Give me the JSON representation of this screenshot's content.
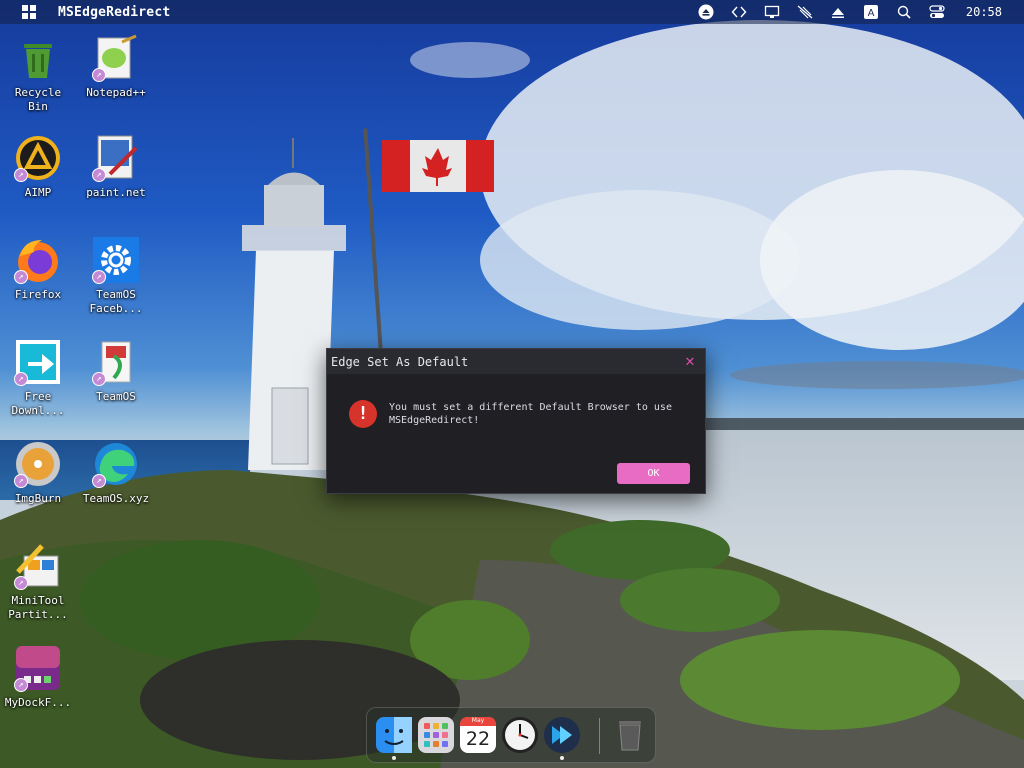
{
  "topbar": {
    "app_title": "MSEdgeRedirect",
    "tray_icons": [
      "eject-icon",
      "code-brackets-icon",
      "monitor-icon",
      "network-off-icon",
      "up-arrow-icon",
      "keyboard-a-icon",
      "search-icon",
      "toggle-icon"
    ],
    "keyboard_letter": "A",
    "clock": "20:58"
  },
  "desktop": {
    "icons": [
      {
        "label": "Recycle\nBin",
        "icon": "recycle-bin-icon"
      },
      {
        "label": "Notepad++",
        "icon": "notepad-plus-plus-icon"
      },
      {
        "label": "AIMP",
        "icon": "aimp-icon"
      },
      {
        "label": "paint.net",
        "icon": "paint-net-icon"
      },
      {
        "label": "Firefox",
        "icon": "firefox-icon"
      },
      {
        "label": "TeamOS\nFaceb...",
        "icon": "gear-icon"
      },
      {
        "label": "Free\nDownl...",
        "icon": "free-download-icon"
      },
      {
        "label": "TeamOS",
        "icon": "teamos-icon"
      },
      {
        "label": "ImgBurn",
        "icon": "imgburn-icon"
      },
      {
        "label": "TeamOS.xyz",
        "icon": "edge-icon"
      },
      {
        "label": "MiniTool\nPartit...",
        "icon": "minitool-partition-icon"
      },
      {
        "label": "MyDockF...",
        "icon": "mydock-icon"
      }
    ]
  },
  "dialog": {
    "title": "Edge Set As Default",
    "message": "You must set a different Default Browser to use MSEdgeRedirect!",
    "ok_label": "OK",
    "error_glyph": "!",
    "close_glyph": "✕"
  },
  "dock": {
    "items": [
      "finder-icon",
      "launchpad-icon",
      "calendar-icon",
      "clock-icon",
      "app-arrow-icon",
      "trash-icon"
    ],
    "calendar_month": "May",
    "calendar_day": "22"
  },
  "colors": {
    "accent": "#e86cc4",
    "error": "#d6332a",
    "dialog_bg": "#1f1f24"
  }
}
